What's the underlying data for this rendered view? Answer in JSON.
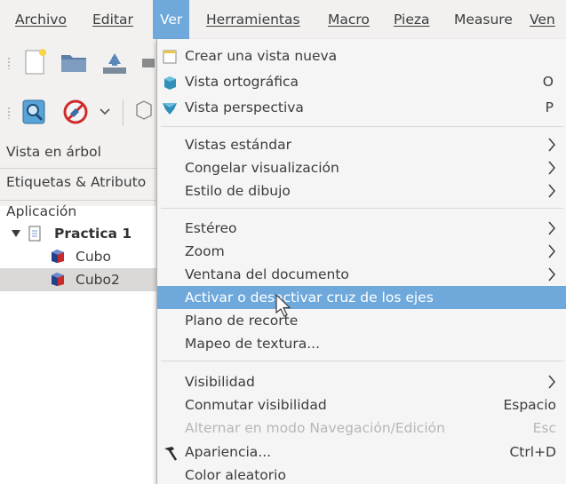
{
  "menubar": {
    "items": [
      {
        "label": "Archivo",
        "u": true
      },
      {
        "label": "Editar",
        "u": true
      },
      {
        "label": "Ver",
        "active": true
      },
      {
        "label": "Herramientas",
        "u": true
      },
      {
        "label": "Macro",
        "u": true
      },
      {
        "label": "Pieza",
        "u": true
      },
      {
        "label": "Measure"
      },
      {
        "label": "Ven",
        "u": true
      }
    ]
  },
  "panel": {
    "tree_title": "Vista en árbol",
    "tab_label": "Etiquetas & Atributo",
    "root_label": "Aplicación",
    "doc_label": "Practica 1",
    "objects": [
      "Cubo",
      "Cubo2"
    ]
  },
  "menu": {
    "new_view": "Crear una vista nueva",
    "ortho": "Vista ortográfica",
    "ortho_sc": "O",
    "persp": "Vista perspectiva",
    "persp_sc": "P",
    "std_views": "Vistas estándar",
    "freeze": "Congelar visualización",
    "draw_style": "Estilo de dibujo",
    "stereo": "Estéreo",
    "zoom": "Zoom",
    "doc_window": "Ventana del documento",
    "axis_cross": "Activar o desactivar cruz de los ejes",
    "clip_plane": "Plano de recorte",
    "texture": "Mapeo de textura...",
    "visibility": "Visibilidad",
    "toggle_vis": "Conmutar visibilidad",
    "toggle_vis_sc": "Espacio",
    "nav_mode": "Alternar en modo Navegación/Edición",
    "nav_mode_sc": "Esc",
    "appearance": "Apariencia...",
    "appearance_sc": "Ctrl+D",
    "random_color": "Color aleatorio"
  },
  "colors": {
    "highlight": "#6fa9dc",
    "menu_bg": "#f5f5f5",
    "window_bg": "#f2f1f0"
  }
}
